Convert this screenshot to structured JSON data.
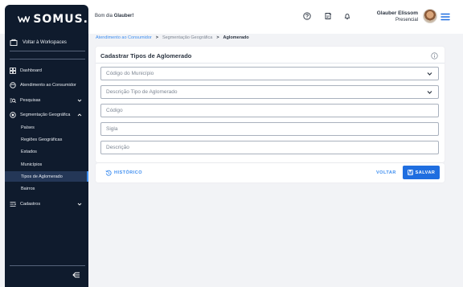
{
  "header": {
    "brand": "SOMUS.",
    "greeting_prefix": "Bom dia",
    "greeting_name": "Glauber!",
    "user_name": "Glauber Elissom",
    "user_status": "Presencial"
  },
  "sidebar": {
    "workspace_label": "Voltar à Workspaces",
    "items": [
      {
        "label": "Dashboard"
      },
      {
        "label": "Atendimento ao Consumidor"
      },
      {
        "label": "Pesquisas"
      },
      {
        "label": "Segmentação Geográfica"
      },
      {
        "label": "Cadastros"
      }
    ],
    "sub_items": [
      {
        "label": "Países"
      },
      {
        "label": "Regiões Geográficas"
      },
      {
        "label": "Estados"
      },
      {
        "label": "Municípios"
      },
      {
        "label": "Tipos de Aglomerado"
      },
      {
        "label": "Bairros"
      }
    ],
    "active_sub_item": "Tipos de Aglomerado"
  },
  "breadcrumb": {
    "items": [
      "Atendimento ao Consumidor",
      "Segmentação Geográfica",
      "Aglomerado"
    ],
    "separator": ">"
  },
  "form": {
    "title": "Cadastrar Tipos de Aglomerado",
    "fields": [
      {
        "placeholder": "Código do Município",
        "type": "select"
      },
      {
        "placeholder": "Descrição Tipo de Aglomerado",
        "type": "select"
      },
      {
        "placeholder": "Código",
        "type": "text"
      },
      {
        "placeholder": "Sigla",
        "type": "text"
      },
      {
        "placeholder": "Descrição",
        "type": "text"
      }
    ]
  },
  "actions": {
    "history": "HISTÓRICO",
    "back": "VOLTAR",
    "save": "SALVAR"
  },
  "colors": {
    "sidebar_bg": "#0f1b2d",
    "accent": "#3e8ef0",
    "primary_button": "#1f6ee0",
    "page_bg": "#f2f3f6"
  }
}
